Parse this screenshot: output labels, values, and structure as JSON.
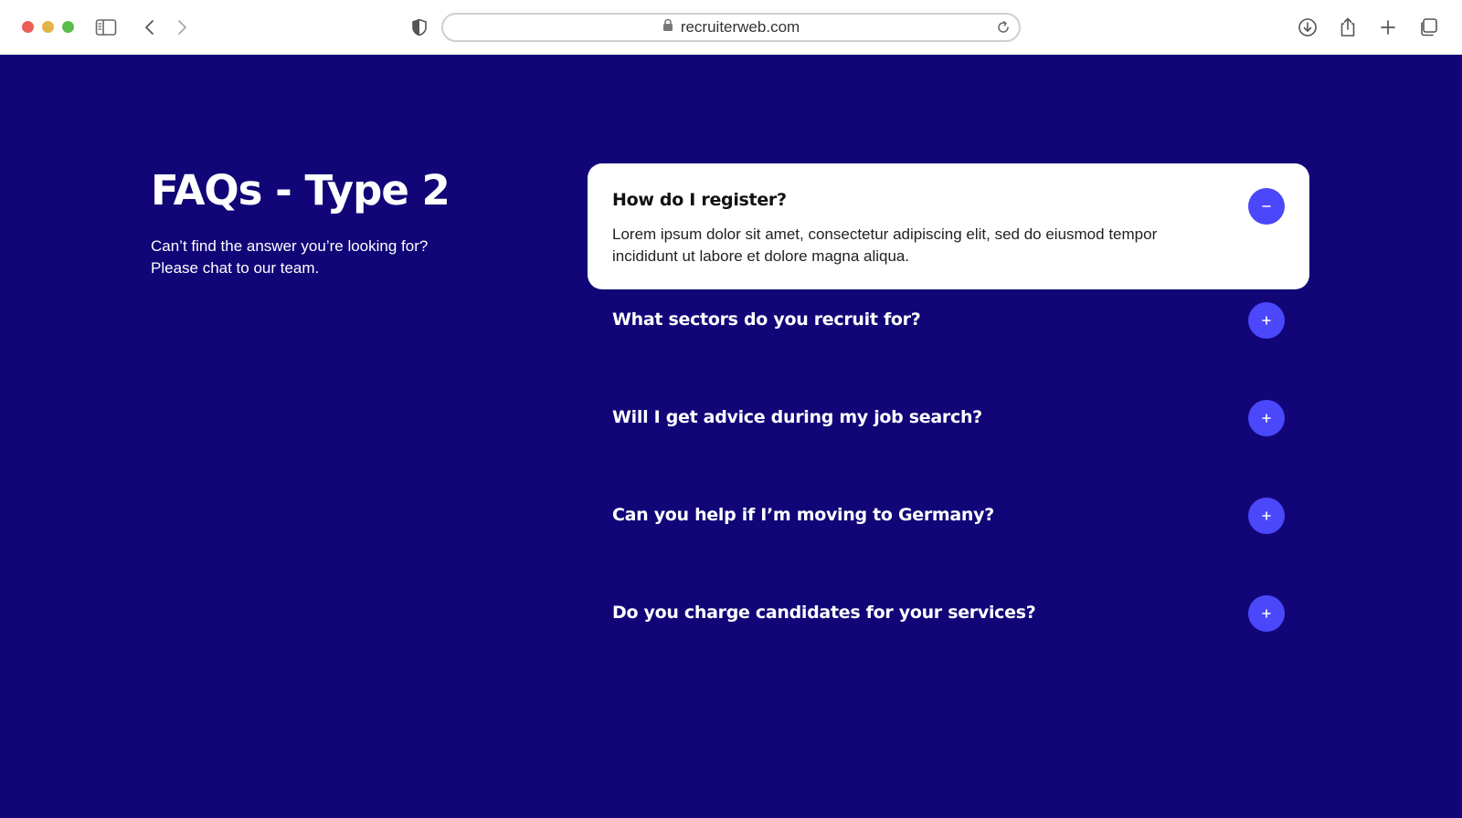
{
  "browser": {
    "url": "recruiterweb.com",
    "icons": [
      "sidebar-icon",
      "back-icon",
      "forward-icon",
      "shield-icon",
      "lock-icon",
      "reload-icon",
      "download-icon",
      "share-icon",
      "new-tab-icon",
      "tabs-overview-icon"
    ]
  },
  "colors": {
    "page_background": "#110578",
    "accent": "#4b47fb",
    "card_background": "#ffffff"
  },
  "hero": {
    "title": "FAQs - Type 2",
    "subtitle_line1": "Can’t find the answer you’re looking for?",
    "subtitle_line2": "Please chat to our team."
  },
  "faqs": [
    {
      "question": "How do I register?",
      "answer_line1": "Lorem ipsum dolor sit amet, consectetur adipiscing elit, sed do eiusmod tempor",
      "answer_line2": "incididunt ut labore et dolore magna aliqua.",
      "expanded": true,
      "toggle_icon": "minus-icon"
    },
    {
      "question": "What sectors do you recruit for?",
      "expanded": false,
      "toggle_icon": "plus-icon"
    },
    {
      "question": "Will I get advice during my job search?",
      "expanded": false,
      "toggle_icon": "plus-icon"
    },
    {
      "question": "Can you help if I’m moving to Germany?",
      "expanded": false,
      "toggle_icon": "plus-icon"
    },
    {
      "question": "Do you charge candidates for your services?",
      "expanded": false,
      "toggle_icon": "plus-icon"
    }
  ]
}
